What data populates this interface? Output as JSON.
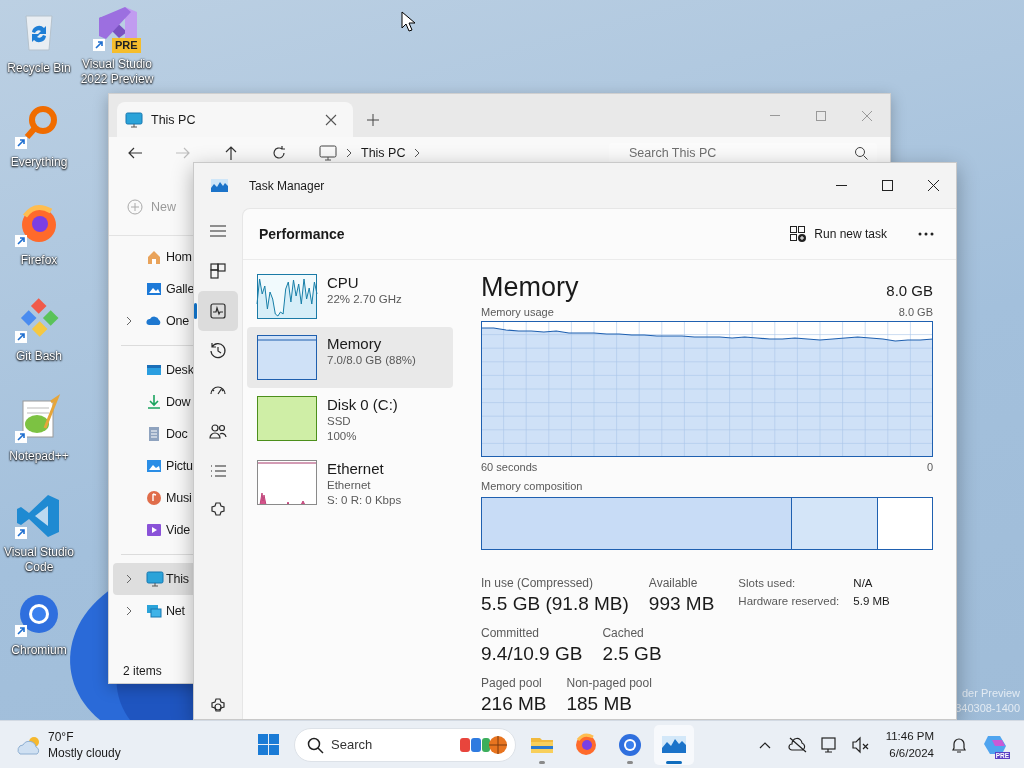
{
  "desktop": {
    "icons": [
      {
        "label": "Recycle Bin"
      },
      {
        "label": "Visual Studio 2022 Preview",
        "badge": "PRE"
      },
      {
        "label": "Everything"
      },
      {
        "label": "Firefox"
      },
      {
        "label": "Git Bash"
      },
      {
        "label": "Notepad++"
      },
      {
        "label": "Visual Studio Code"
      },
      {
        "label": "Chromium"
      }
    ],
    "watermark": [
      "der Preview",
      "340308-1400"
    ]
  },
  "explorer": {
    "tab": {
      "title": "This PC"
    },
    "nav": [
      {
        "disabled": false
      },
      {
        "disabled": true
      },
      {
        "disabled": false
      },
      {
        "disabled": false
      }
    ],
    "breadcrumb": [
      "This PC"
    ],
    "search": {
      "placeholder": "Search This PC"
    },
    "new_button": {
      "label": "New",
      "disabled": true
    },
    "sidebar": [
      [
        {
          "label": "Hom",
          "expandable": false,
          "selected": false
        },
        {
          "label": "Galle",
          "expandable": false,
          "selected": false
        },
        {
          "label": "One",
          "expandable": true,
          "selected": false
        }
      ],
      [
        {
          "label": "Desk",
          "expandable": false,
          "selected": false
        },
        {
          "label": "Dow",
          "expandable": false,
          "selected": false
        },
        {
          "label": "Doc",
          "expandable": false,
          "selected": false
        },
        {
          "label": "Pictu",
          "expandable": false,
          "selected": false
        },
        {
          "label": "Musi",
          "expandable": false,
          "selected": false
        },
        {
          "label": "Vide",
          "expandable": false,
          "selected": false
        }
      ],
      [
        {
          "label": "This",
          "expandable": true,
          "selected": true
        },
        {
          "label": "Net",
          "expandable": true,
          "selected": false
        }
      ]
    ],
    "status": "2 items"
  },
  "task_manager": {
    "title": "Task Manager",
    "nav": [
      {
        "selected": false
      },
      {
        "selected": false
      },
      {
        "selected": true
      },
      {
        "selected": false
      },
      {
        "selected": false
      },
      {
        "selected": false
      },
      {
        "selected": false
      },
      {
        "selected": false
      },
      {
        "selected": false
      }
    ],
    "page_title": "Performance",
    "run_new_task": "Run new task",
    "resources": [
      {
        "name": "CPU",
        "details": [
          "22% 2.70 GHz"
        ],
        "selected": false
      },
      {
        "name": "Memory",
        "details": [
          "7.0/8.0 GB (88%)"
        ],
        "selected": true
      },
      {
        "name": "Disk 0 (C:)",
        "details": [
          "SSD",
          "100%"
        ],
        "selected": false
      },
      {
        "name": "Ethernet",
        "details": [
          "Ethernet",
          "S: 0 R: 0 Kbps"
        ],
        "selected": false
      }
    ],
    "detail": {
      "title": "Memory",
      "total": "8.0 GB",
      "usage_label": "Memory usage",
      "usage_max": "8.0 GB",
      "time_start": "60 seconds",
      "time_end": "0",
      "composition_label": "Memory composition",
      "composition": [
        {
          "kind": "in_use"
        },
        {
          "kind": "standby"
        },
        {
          "kind": "free"
        }
      ],
      "stat_rows": [
        [
          {
            "label": "In use (Compressed)",
            "value": "5.5 GB (91.8 MB)"
          },
          {
            "label": "Available",
            "value": "993 MB"
          }
        ],
        [
          {
            "label": "Committed",
            "value": "9.4/10.9 GB"
          },
          {
            "label": "Cached",
            "value": "2.5 GB"
          }
        ],
        [
          {
            "label": "Paged pool",
            "value": "216 MB"
          },
          {
            "label": "Non-paged pool",
            "value": "185 MB"
          }
        ]
      ],
      "hardware": [
        {
          "label": "Slots used:",
          "value": "N/A"
        },
        {
          "label": "Hardware reserved:",
          "value": "5.9 MB"
        }
      ]
    }
  },
  "taskbar": {
    "weather": {
      "temperature": "70°F",
      "condition": "Mostly cloudy"
    },
    "search": {
      "placeholder": "Search"
    },
    "apps": [
      {
        "running": true,
        "active": false
      },
      {
        "running": false,
        "active": false
      },
      {
        "running": true,
        "active": false
      },
      {
        "running": true,
        "active": true
      }
    ],
    "time": "11:46 PM",
    "date": "6/6/2024",
    "copilot_badge": "PRE"
  }
}
